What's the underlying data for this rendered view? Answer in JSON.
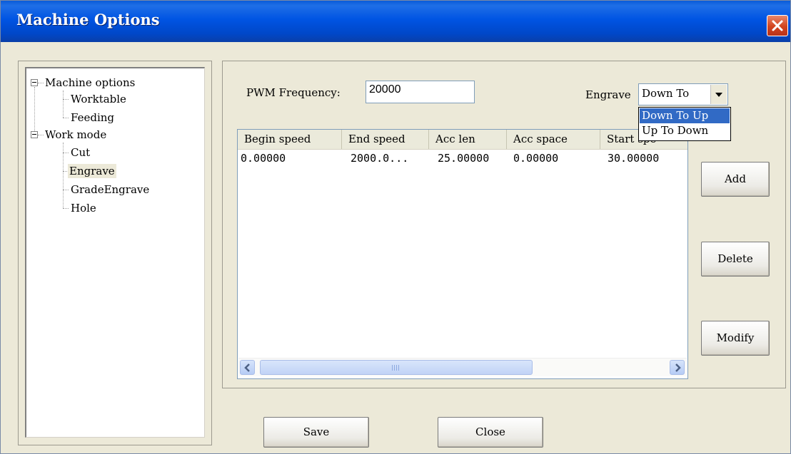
{
  "window": {
    "title": "Machine Options",
    "close_icon": "close-icon"
  },
  "tree": {
    "nodes": [
      {
        "label": "Machine options"
      },
      {
        "label": "Worktable"
      },
      {
        "label": "Feeding"
      },
      {
        "label": "Work mode"
      },
      {
        "label": "Cut"
      },
      {
        "label": "Engrave",
        "selected": true
      },
      {
        "label": "GradeEngrave"
      },
      {
        "label": "Hole"
      }
    ]
  },
  "settings": {
    "pwm_label": "PWM Frequency:",
    "pwm_value": "20000",
    "engrave_label": "Engrave",
    "engrave_selected": "Down To",
    "engrave_options": [
      "Down To Up",
      "Up To Down"
    ],
    "engrave_highlighted": "Down To Up"
  },
  "table": {
    "columns": [
      "Begin speed",
      "End speed",
      "Acc len",
      "Acc space",
      "Start spe"
    ],
    "rows": [
      [
        "0.00000",
        "2000.0...",
        "25.00000",
        "0.00000",
        "30.00000"
      ]
    ]
  },
  "buttons": {
    "add": "Add",
    "delete": "Delete",
    "modify": "Modify",
    "save": "Save",
    "close": "Close"
  },
  "colors": {
    "titlebar": "#0054e3",
    "selection": "#316ac5",
    "dialog": "#ece9d8",
    "close": "#d2441e"
  }
}
